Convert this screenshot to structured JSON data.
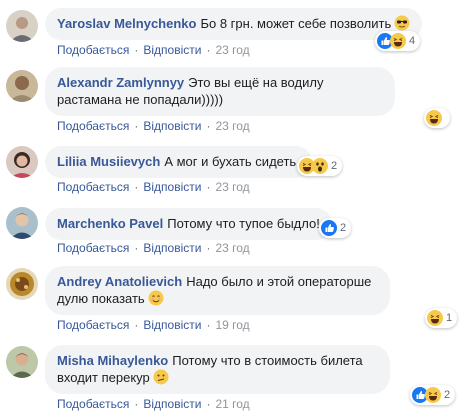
{
  "actions": {
    "like": "Подобається",
    "reply": "Відповісти",
    "separator": "·"
  },
  "comments": [
    {
      "author": "Yaroslav Melnychenko",
      "text": "Бо 8 грн. может себе позволить",
      "time": "23 год",
      "reaction_count": "4"
    },
    {
      "author": "Alexandr Zamlynnyy",
      "text": "Это вы ещё на водилу растамана не попадали)))))",
      "time": "23 год",
      "reaction_count": ""
    },
    {
      "author": "Liliia Musiievych",
      "text": "А мог и бухать сидеть.",
      "time": "23 год",
      "reaction_count": "2"
    },
    {
      "author": "Marchenko Pavel",
      "text": "Потому что тупое быдло!",
      "time": "23 год",
      "reaction_count": "2"
    },
    {
      "author": "Andrey Anatolievich",
      "text": "Надо было и этой операторше дулю показать",
      "time": "19 год",
      "reaction_count": "1"
    },
    {
      "author": "Misha Mihaylenko",
      "text": "Потому что в стоимость билета входит перекур",
      "time": "21 год",
      "reaction_count": "2"
    }
  ]
}
